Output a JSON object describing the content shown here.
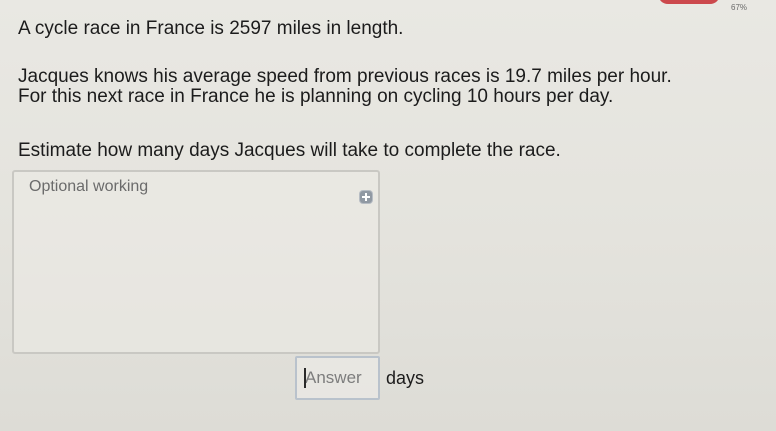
{
  "question": {
    "line1": "A cycle race in France is 2597 miles in length.",
    "line2": "Jacques knows his average speed from previous races is 19.7 miles per hour.",
    "line3": "For this next race in France he is planning on cycling 10 hours per day.",
    "line4": "Estimate how many days Jacques will take to complete the race."
  },
  "status": {
    "percent": "67%"
  },
  "working": {
    "label": "Optional working",
    "expand_icon": "plus-square-icon"
  },
  "answer": {
    "placeholder": "Answer",
    "value": "",
    "unit": "days"
  },
  "colors": {
    "background": "#e6e5df",
    "text": "#1c1c1c",
    "accent_mark": "#c9373c",
    "field_border": "#b9c2cc"
  }
}
